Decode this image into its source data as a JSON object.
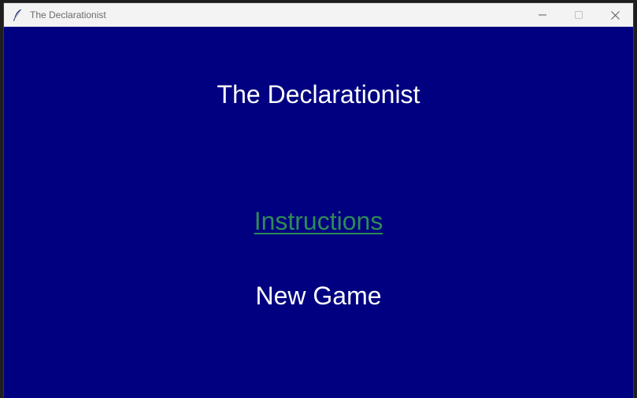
{
  "window": {
    "title": "The Declarationist",
    "icon": "feather-icon",
    "controls": [
      "minimize-icon",
      "maximize-icon",
      "close-icon"
    ]
  },
  "main": {
    "heading": "The Declarationist",
    "menu": {
      "instructions_label": "Instructions",
      "new_game_label": "New Game"
    }
  },
  "colors": {
    "background": "#000080",
    "titlebar": "#f3f3f3",
    "heading_text": "#ffffff",
    "instructions_text": "#2e8b57",
    "new_game_text": "#ffffff"
  }
}
